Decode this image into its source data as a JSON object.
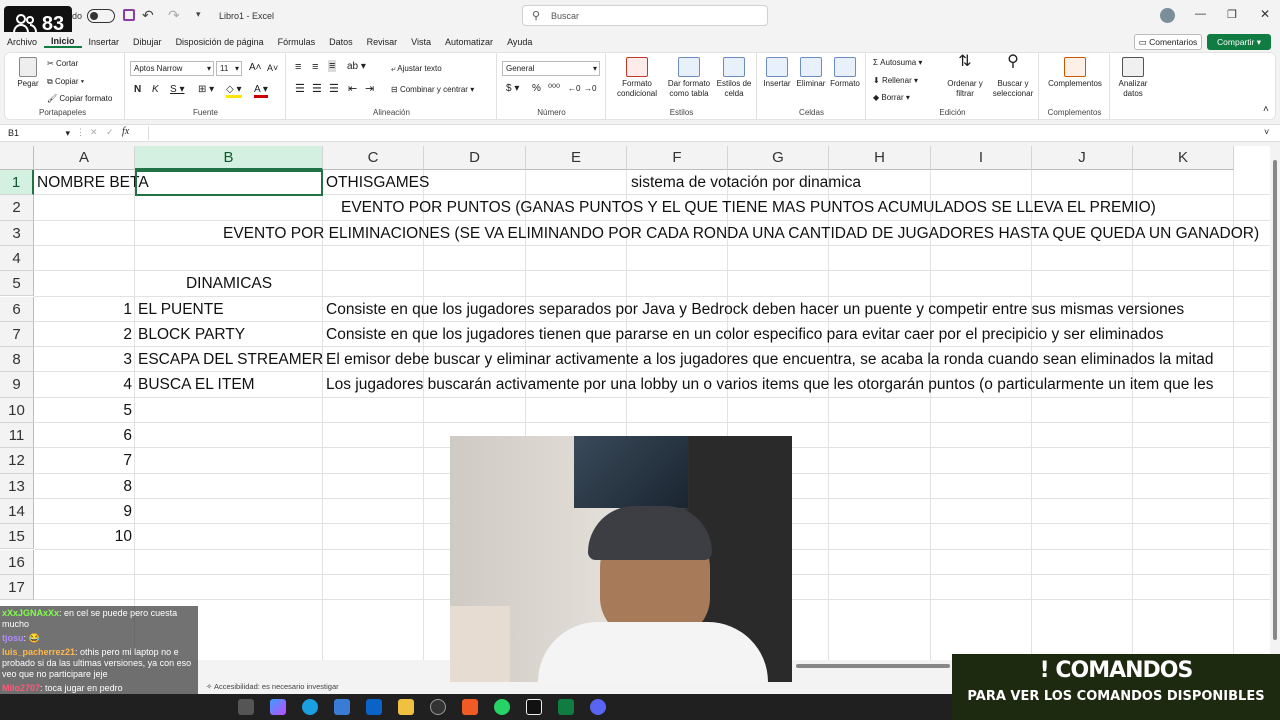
{
  "viewer_badge": {
    "count": "83"
  },
  "titlebar": {
    "autosave_label": "do",
    "file_name": "Libro1 - Excel",
    "search_placeholder": "Buscar"
  },
  "menu": {
    "tabs": [
      "Archivo",
      "Inicio",
      "Insertar",
      "Dibujar",
      "Disposición de página",
      "Fórmulas",
      "Datos",
      "Revisar",
      "Vista",
      "Automatizar",
      "Ayuda"
    ],
    "comments_label": "Comentarios",
    "share_label": "Compartir"
  },
  "ribbon": {
    "clipboard": {
      "paste": "Pegar",
      "cut": "Cortar",
      "copy": "Copiar",
      "format_painter": "Copiar formato",
      "group": "Portapapeles"
    },
    "font": {
      "name": "Aptos Narrow",
      "size": "11",
      "group": "Fuente"
    },
    "alignment": {
      "wrap": "Ajustar texto",
      "merge": "Combinar y centrar",
      "group": "Alineación"
    },
    "number": {
      "format": "General",
      "group": "Número"
    },
    "styles": {
      "conditional": "Formato condicional",
      "table": "Dar formato como tabla",
      "cell_styles": "Estilos de celda",
      "group": "Estilos"
    },
    "cells": {
      "insert": "Insertar",
      "delete": "Eliminar",
      "format": "Formato",
      "group": "Celdas"
    },
    "editing": {
      "autosum": "Autosuma",
      "fill": "Rellenar",
      "clear": "Borrar",
      "sort": "Ordenar y filtrar",
      "find": "Buscar y seleccionar",
      "group": "Edición"
    },
    "addins": {
      "complementos": "Complementos",
      "group": "Complementos"
    },
    "analyze": {
      "label": "Analizar datos"
    }
  },
  "formula_bar": {
    "cell_ref": "B1",
    "fx": "fx",
    "value": ""
  },
  "columns": [
    "A",
    "B",
    "C",
    "D",
    "E",
    "F",
    "G",
    "H",
    "I",
    "J",
    "K"
  ],
  "rows": [
    "1",
    "2",
    "3",
    "4",
    "5",
    "6",
    "7",
    "8",
    "9",
    "10",
    "11",
    "12",
    "13",
    "14",
    "15",
    "16",
    "17"
  ],
  "cells": {
    "A1": "NOMBRE BETA",
    "C1": "OTHISGAMES",
    "G1": "sistema de votación por dinamica",
    "C2": "EVENTO POR PUNTOS (GANAS PUNTOS Y EL QUE TIENE MAS PUNTOS ACUMULADOS SE LLEVA EL PREMIO)",
    "B3": "EVENTO POR ELIMINACIONES (SE VA ELIMINANDO POR CADA RONDA UNA CANTIDAD DE JUGADORES HASTA QUE QUEDA UN GANADOR)",
    "B5": "DINAMICAS",
    "A6": "1",
    "B6": "EL PUENTE",
    "C6": "Consiste en que los jugadores separados por Java y Bedrock deben hacer un puente y competir entre sus mismas versiones",
    "A7": "2",
    "B7": "BLOCK PARTY",
    "C7": "Consiste en que los jugadores tienen que pararse en un color especifico para evitar caer por el precipicio y ser eliminados",
    "A8": "3",
    "B8": "ESCAPA DEL STREAMER",
    "C8": "El emisor debe buscar y eliminar activamente a los jugadores que encuentra, se acaba la ronda cuando sean eliminados la mitad",
    "A9": "4",
    "B9": "BUSCA EL ITEM",
    "C9": "Los jugadores buscarán activamente por una lobby un o varios items que les otorgarán puntos (o particularmente un item que les",
    "A10": "5",
    "A11": "6",
    "A12": "7",
    "A13": "8",
    "A14": "9",
    "A15": "10"
  },
  "chat": [
    {
      "user": "xXxJGNAxXx",
      "text": ": en cel se puede pero cuesta mucho"
    },
    {
      "user": "tjosu",
      "text": ": 😂"
    },
    {
      "user": "luis_pacherrez21",
      "text": ": othis pero mi laptop no e probado si da las ultimas versiones, ya con eso veo que no participare jeje"
    },
    {
      "user": "Milo2707",
      "text": ": toca jugar en pedro"
    }
  ],
  "status_bar": {
    "accessibility": "Accesibilidad: es necesario investigar"
  },
  "commands_overlay": {
    "title": "! COMANDOS",
    "subtitle": "PARA VER LOS COMANDOS DISPONIBLES"
  },
  "colors": {
    "excel_green": "#107c41",
    "selection": "#217346"
  }
}
